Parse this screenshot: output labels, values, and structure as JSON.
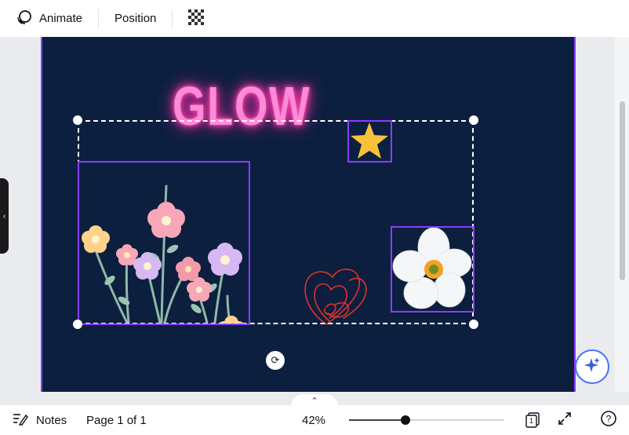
{
  "toolbar": {
    "animate_label": "Animate",
    "position_label": "Position",
    "icons": [
      "animate-icon",
      "transparency-icon"
    ]
  },
  "canvas": {
    "title_text": "GLOW",
    "page_color": "#0c1f3f",
    "selection_color": "#8b3dff",
    "elements": [
      "flowers-bouquet",
      "star",
      "heart-doodle",
      "white-anemone-flower"
    ]
  },
  "bottom_bar": {
    "notes_label": "Notes",
    "page_label": "Page 1 of 1",
    "zoom_label": "42%",
    "zoom_level_percent": 42,
    "pages_count": "1"
  }
}
